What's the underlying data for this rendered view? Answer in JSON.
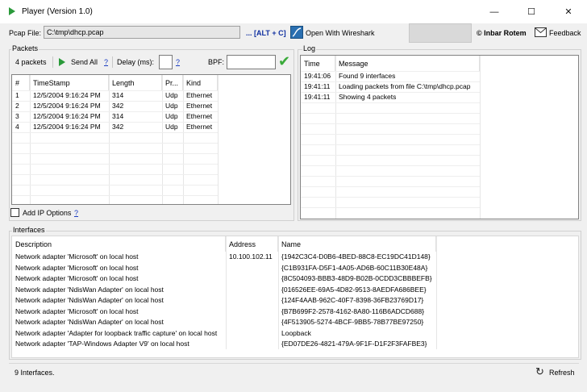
{
  "window": {
    "title": "Player (Version 1.0)",
    "minimize_glyph": "—",
    "maximize_glyph": "☐",
    "close_glyph": "✕"
  },
  "toolbar": {
    "pcap_label": "Pcap File:",
    "pcap_value": "C:\\tmp\\dhcp.pcap",
    "hotkey": "... [ALT + C]",
    "wireshark_label": "Open With Wireshark",
    "copyright": "© Inbar Rotem",
    "feedback": "Feedback"
  },
  "packets": {
    "group_title": "Packets",
    "count_label": "4 packets",
    "send_all": "Send All",
    "help": "?",
    "delay_label": "Delay (ms):",
    "delay_value": "",
    "bpf_label": "BPF:",
    "bpf_value": "",
    "columns": [
      "#",
      "TimeStamp",
      "Length",
      "Pr...",
      "Kind"
    ],
    "rows": [
      [
        "1",
        "12/5/2004 9:16:24 PM",
        "314",
        "Udp",
        "Ethernet"
      ],
      [
        "2",
        "12/5/2004 9:16:24 PM",
        "342",
        "Udp",
        "Ethernet"
      ],
      [
        "3",
        "12/5/2004 9:16:24 PM",
        "314",
        "Udp",
        "Ethernet"
      ],
      [
        "4",
        "12/5/2004 9:16:24 PM",
        "342",
        "Udp",
        "Ethernet"
      ]
    ],
    "add_ip_options": "Add IP Options",
    "add_ip_checked": false
  },
  "log": {
    "group_title": "Log",
    "columns": [
      "Time",
      "Message"
    ],
    "rows": [
      [
        "19:41:06",
        "Found 9 interfaces"
      ],
      [
        "19:41:11",
        "Loading packets from file C:\\tmp\\dhcp.pcap"
      ],
      [
        "19:41:11",
        "Showing 4 packets"
      ]
    ]
  },
  "interfaces": {
    "group_title": "Interfaces",
    "columns": [
      "Description",
      "Address",
      "Name"
    ],
    "rows": [
      [
        "Network adapter 'Microsoft' on local host",
        "10.100.102.11",
        "{1942C3C4-D0B6-4BED-88C8-EC19DC41D148}"
      ],
      [
        "Network adapter 'Microsoft' on local host",
        "",
        "{C1B931FA-D5F1-4A05-AD6B-60C11B30E48A}"
      ],
      [
        "Network adapter 'Microsoft' on local host",
        "",
        "{8C504093-BBB3-48D9-B02B-0CDD3CBBBEFB}"
      ],
      [
        "Network adapter 'NdisWan Adapter' on local host",
        "",
        "{016526EE-69A5-4D82-9513-8AEDFA686BEE}"
      ],
      [
        "Network adapter 'NdisWan Adapter' on local host",
        "",
        "{124F4AAB-962C-40F7-8398-36FB23769D17}"
      ],
      [
        "Network adapter 'Microsoft' on local host",
        "",
        "{B7B699F2-2578-4162-8A80-116B6ADCD688}"
      ],
      [
        "Network adapter 'NdisWan Adapter' on local host",
        "",
        "{4F513905-5274-4BCF-9BB5-78B77BE97250}"
      ],
      [
        "Network adapter 'Adapter for loopback traffic capture' on local host",
        "",
        "Loopback"
      ],
      [
        "Network adapter 'TAP-Windows Adapter V9' on local host",
        "",
        "{ED07DE26-4821-479A-9F1F-D1F2F3FAFBE3}"
      ]
    ]
  },
  "status": {
    "text": "9 Interfaces.",
    "refresh": "Refresh"
  },
  "icons": {
    "app": "play-icon",
    "wireshark": "wireshark-icon",
    "mail": "mail-icon",
    "refresh": "refresh-icon",
    "check": "check-icon"
  },
  "colors": {
    "play_green": "#2a9a3a",
    "link_blue": "#1a3cc0",
    "hotkey_blue": "#1030a0"
  }
}
